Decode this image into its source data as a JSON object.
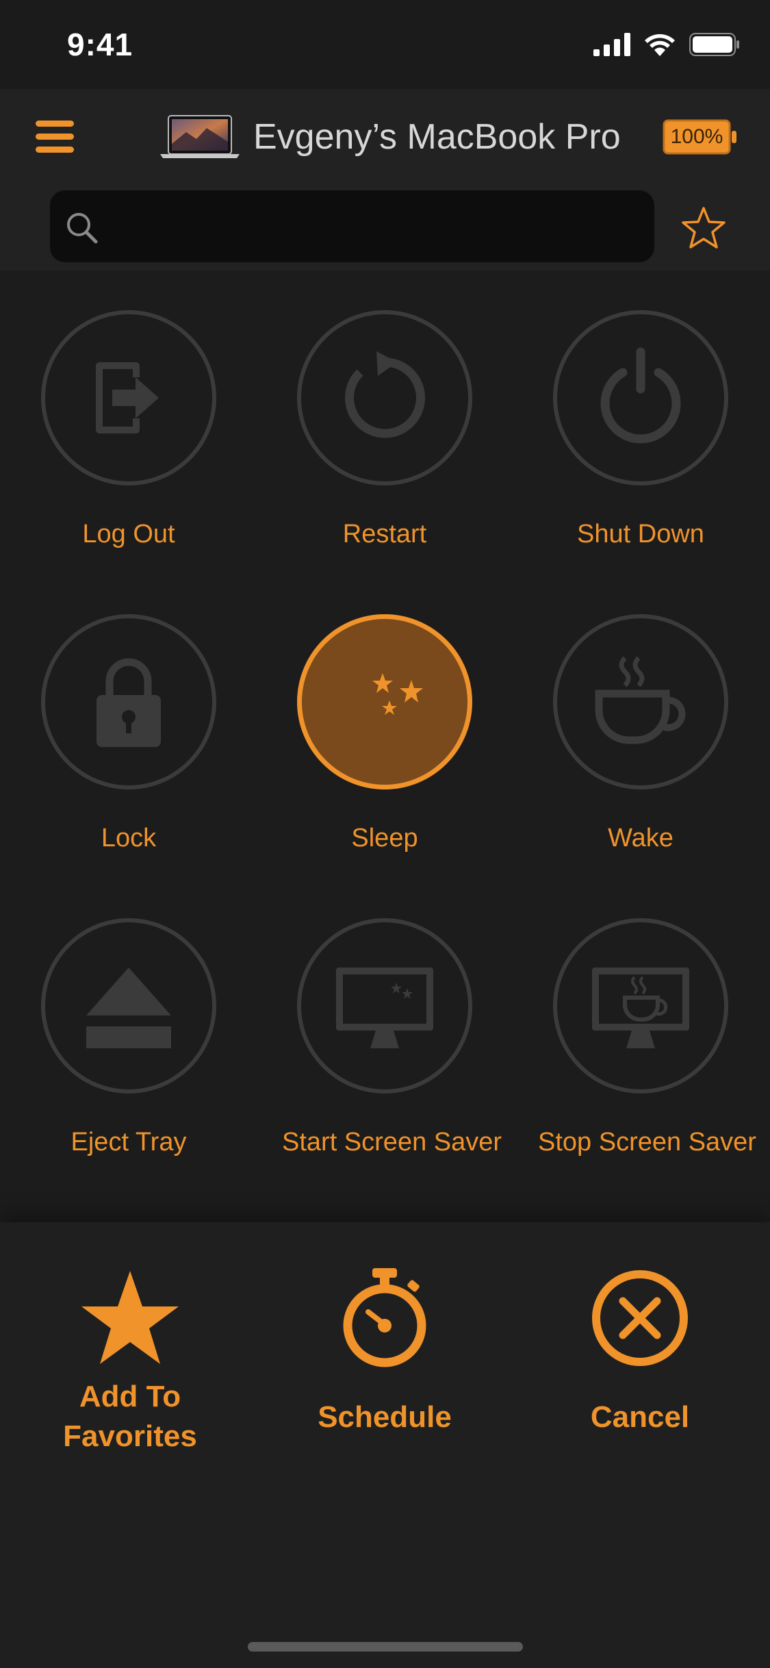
{
  "status": {
    "time": "9:41"
  },
  "header": {
    "title": "Evgeny’s MacBook Pro",
    "battery": "100%"
  },
  "search": {
    "placeholder": "",
    "value": ""
  },
  "colors": {
    "accent": "#f0932b",
    "ring": "#3b3b3b",
    "active_fill": "#7a4a1c"
  },
  "grid": {
    "items": [
      {
        "label": "Log Out",
        "icon": "log-out-icon"
      },
      {
        "label": "Restart",
        "icon": "restart-icon"
      },
      {
        "label": "Shut Down",
        "icon": "power-icon"
      },
      {
        "label": "Lock",
        "icon": "lock-icon"
      },
      {
        "label": "Sleep",
        "icon": "moon-stars-icon",
        "selected": true
      },
      {
        "label": "Wake",
        "icon": "coffee-cup-icon"
      },
      {
        "label": "Eject Tray",
        "icon": "eject-icon"
      },
      {
        "label": "Start Screen Saver",
        "icon": "monitor-moon-icon"
      },
      {
        "label": "Stop Screen Saver",
        "icon": "monitor-cup-icon"
      }
    ]
  },
  "actions": [
    {
      "label": "Add To Favorites",
      "icon": "star-icon"
    },
    {
      "label": "Schedule",
      "icon": "stopwatch-icon"
    },
    {
      "label": "Cancel",
      "icon": "close-circle-icon"
    }
  ]
}
